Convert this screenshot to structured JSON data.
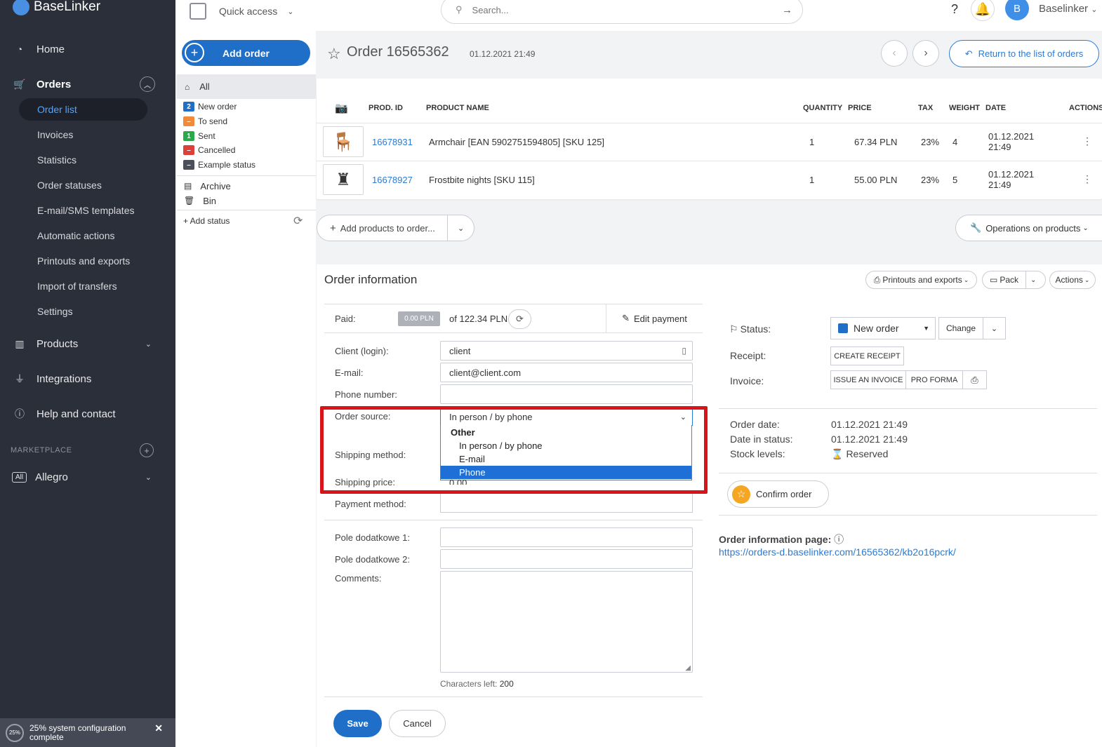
{
  "app": {
    "name": "BaseLinker"
  },
  "sidebar": {
    "main": [
      {
        "label": "Home",
        "icon": "dashboard-icon"
      },
      {
        "label": "Orders",
        "icon": "cart-icon"
      },
      {
        "label": "Products",
        "icon": "warehouse-icon"
      },
      {
        "label": "Integrations",
        "icon": "plug-icon"
      },
      {
        "label": "Help and contact",
        "icon": "help-icon"
      }
    ],
    "orders_sub": [
      "Order list",
      "Invoices",
      "Statistics",
      "Order statuses",
      "E-mail/SMS templates",
      "Automatic actions",
      "Printouts and exports",
      "Import of transfers",
      "Settings"
    ],
    "marketplace_label": "MARKETPLACE",
    "allegro_badge": "All",
    "allegro_label": "Allegro",
    "config_percent": "25%",
    "config_text": "25% system configuration complete"
  },
  "topbar": {
    "quick_access": "Quick access",
    "search_placeholder": "Search...",
    "avatar_letter": "B",
    "username": "Baselinker"
  },
  "statuses": {
    "add_order": "Add order",
    "all": "All",
    "items": [
      {
        "badge": "2",
        "label": "New order",
        "color": "#1f6fc9"
      },
      {
        "badge": "–",
        "label": "To send",
        "color": "#f08a3c"
      },
      {
        "badge": "1",
        "label": "Sent",
        "color": "#2aa84a"
      },
      {
        "badge": "–",
        "label": "Cancelled",
        "color": "#d9413a"
      },
      {
        "badge": "–",
        "label": "Example status",
        "color": "#4a4f59"
      }
    ],
    "archive": "Archive",
    "bin": "Bin",
    "add_status": "+ Add status"
  },
  "order": {
    "title": "Order 16565362",
    "date": "01.12.2021 21:49",
    "return_label": "Return to the list of orders"
  },
  "products": {
    "headers": [
      "PROD. ID",
      "PRODUCT NAME",
      "QUANTITY",
      "PRICE",
      "TAX",
      "WEIGHT",
      "DATE",
      "ACTIONS"
    ],
    "rows": [
      {
        "id": "16678931",
        "name": "Armchair [EAN 5902751594805] [SKU 125]",
        "qty": "1",
        "price": "67.34 PLN",
        "tax": "23%",
        "weight": "4",
        "date1": "01.12.2021",
        "date2": "21:49"
      },
      {
        "id": "16678927",
        "name": "Frostbite nights [SKU 115]",
        "qty": "1",
        "price": "55.00 PLN",
        "tax": "23%",
        "weight": "5",
        "date1": "01.12.2021",
        "date2": "21:49"
      }
    ],
    "add_products": "Add products to order...",
    "operations": "Operations on products"
  },
  "info": {
    "title": "Order information",
    "printouts": "Printouts and exports",
    "pack": "Pack",
    "actions": "Actions",
    "paid_label": "Paid:",
    "paid_value": "0.00 PLN",
    "paid_of": "of",
    "paid_total": "122.34 PLN",
    "edit_payment": "Edit payment",
    "client_label": "Client (login):",
    "client_value": "client",
    "email_label": "E-mail:",
    "email_value": "client@client.com",
    "phone_label": "Phone number:",
    "phone_value": "",
    "source_label": "Order source:",
    "source_value": "In person / by phone",
    "source_group": "Other",
    "source_options": [
      "In person / by phone",
      "E-mail",
      "Phone"
    ],
    "source_highlighted": "Phone",
    "shipping_method_label": "Shipping method:",
    "shipping_price_label": "Shipping price:",
    "shipping_price_value": "0.00",
    "payment_method_label": "Payment method:",
    "extra1_label": "Pole dodatkowe 1:",
    "extra2_label": "Pole dodatkowe 2:",
    "comments_label": "Comments:",
    "chars_left_label": "Characters left:",
    "chars_left_value": "200",
    "save": "Save",
    "cancel": "Cancel"
  },
  "right": {
    "status_label": "Status:",
    "status_value": "New order",
    "change": "Change",
    "receipt_label": "Receipt:",
    "create_receipt": "CREATE RECEIPT",
    "invoice_label": "Invoice:",
    "issue_invoice": "ISSUE AN INVOICE",
    "pro_forma": "PRO FORMA",
    "order_date_label": "Order date:",
    "order_date_value": "01.12.2021 21:49",
    "date_status_label": "Date in status:",
    "date_status_value": "01.12.2021 21:49",
    "stock_label": "Stock levels:",
    "stock_value": "Reserved",
    "confirm_order": "Confirm order",
    "info_page_label": "Order information page:",
    "info_page_url": "https://orders-d.baselinker.com/16565362/kb2o16pcrk/"
  }
}
